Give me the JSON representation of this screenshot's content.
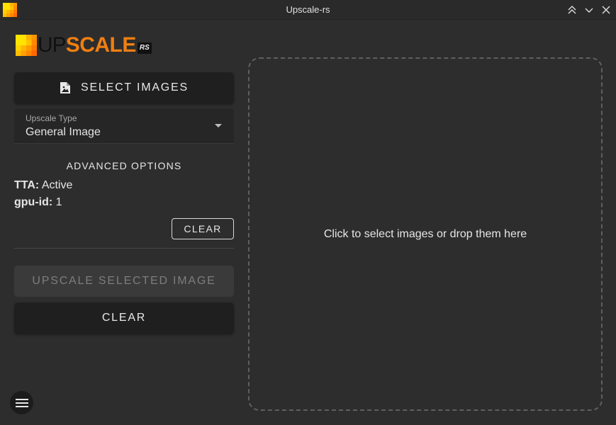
{
  "window": {
    "title": "Upscale-rs",
    "controls": [
      "keep-above-icon",
      "minimize-icon",
      "close-icon"
    ]
  },
  "logo": {
    "part1": "UP",
    "part2": "SCALE",
    "badge": "RS",
    "accent_color": "#f07f12"
  },
  "sidebar": {
    "select_images_label": "SELECT IMAGES",
    "upscale_type": {
      "label": "Upscale Type",
      "value": "General Image"
    },
    "advanced": {
      "title": "ADVANCED OPTIONS",
      "options": [
        {
          "key": "TTA:",
          "value": "Active"
        },
        {
          "key": "gpu-id:",
          "value": "1"
        }
      ],
      "clear_label": "CLEAR"
    },
    "upscale_label": "UPSCALE SELECTED IMAGE",
    "clear_label": "CLEAR"
  },
  "dropzone": {
    "text": "Click to select images or drop them here"
  },
  "icons": {
    "select_images": "image-file-icon",
    "menu": "menu-icon"
  }
}
